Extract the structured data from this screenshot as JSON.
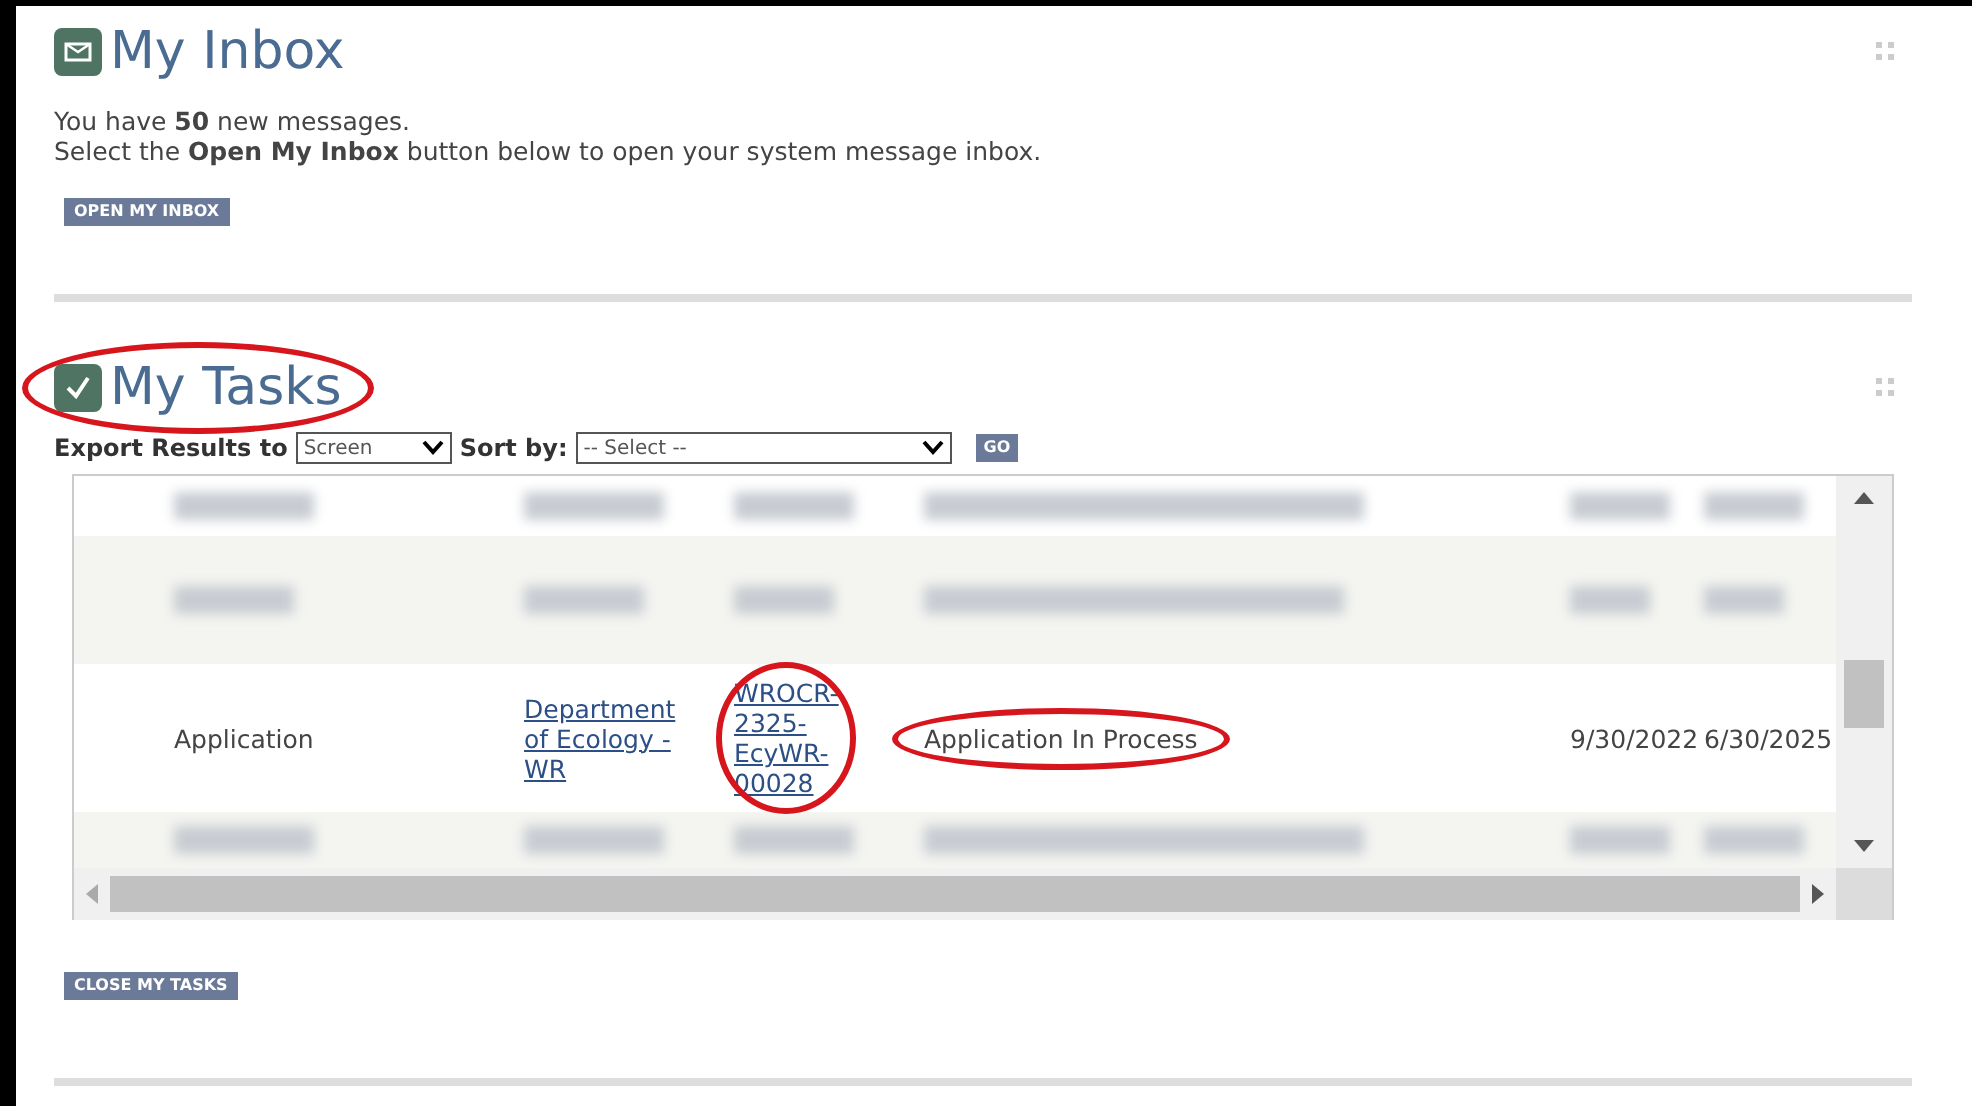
{
  "inbox": {
    "title": "My Inbox",
    "message": "You have **50** new messages.",
    "instruction": "Select the **Open My Inbox** button below to open your system message inbox.",
    "button": "OPEN MY INBOX"
  },
  "tasks": {
    "title": "My Tasks",
    "title_annotated": true,
    "export_label": "Export Results to",
    "export_value": "Screen",
    "sort_label": "Sort by:",
    "sort_value": "-- Select --",
    "go_button": "GO",
    "rows": [
      {
        "kind": "redacted"
      },
      {
        "kind": "redacted"
      },
      {
        "kind": "task",
        "cells": [
          {
            "text": "Application",
            "link": false,
            "annotated": false
          },
          {
            "text": "Department of Ecology - WR",
            "link": true,
            "annotated": false
          },
          {
            "text": "WROCR-2325-EcyWR-00028",
            "link": true,
            "annotated": true
          },
          {
            "text": "Application In Process",
            "link": false,
            "annotated": true
          },
          {
            "text": "9/30/2022",
            "link": false,
            "annotated": false
          },
          {
            "text": "6/30/2025",
            "link": false,
            "annotated": false
          }
        ]
      },
      {
        "kind": "redacted"
      }
    ],
    "close_button": "CLOSE MY TASKS"
  }
}
